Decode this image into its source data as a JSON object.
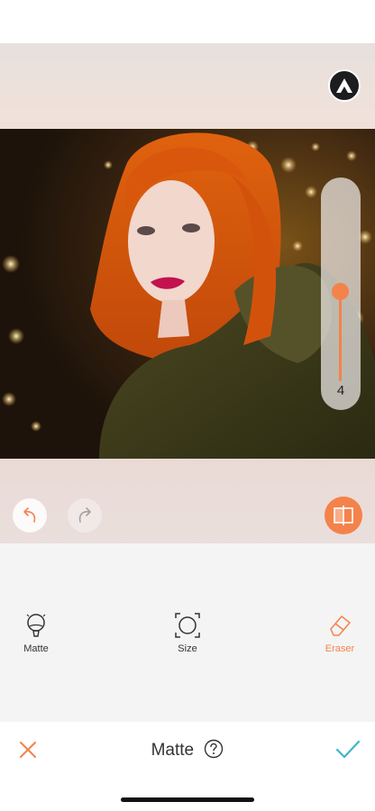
{
  "editor": {
    "brush_size_value": "4",
    "brush_level_fraction": 0.5
  },
  "tools": [
    {
      "label": "Matte",
      "icon": "matte-balloon-icon",
      "active": false
    },
    {
      "label": "Size",
      "icon": "size-frame-icon",
      "active": false
    },
    {
      "label": "Eraser",
      "icon": "eraser-icon",
      "active": true
    }
  ],
  "bottom_bar": {
    "title": "Matte",
    "help_icon": "help-circle-icon",
    "cancel_icon": "close-x-icon",
    "confirm_icon": "checkmark-icon"
  },
  "colors": {
    "accent_orange": "#f3834a",
    "confirm_teal": "#3fb6c9",
    "panel_gray": "#f4f4f4"
  }
}
